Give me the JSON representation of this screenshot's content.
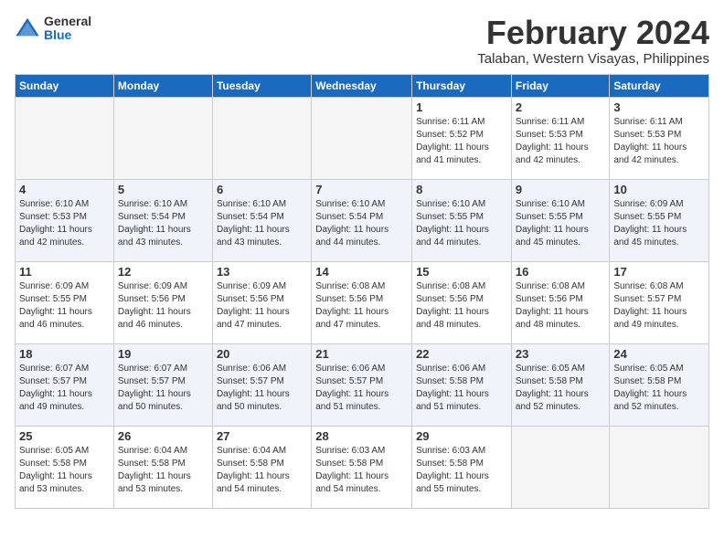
{
  "logo": {
    "general": "General",
    "blue": "Blue"
  },
  "title": "February 2024",
  "subtitle": "Talaban, Western Visayas, Philippines",
  "headers": [
    "Sunday",
    "Monday",
    "Tuesday",
    "Wednesday",
    "Thursday",
    "Friday",
    "Saturday"
  ],
  "weeks": [
    [
      {
        "day": "",
        "detail": "",
        "empty": true
      },
      {
        "day": "",
        "detail": "",
        "empty": true
      },
      {
        "day": "",
        "detail": "",
        "empty": true
      },
      {
        "day": "",
        "detail": "",
        "empty": true
      },
      {
        "day": "1",
        "detail": "Sunrise: 6:11 AM\nSunset: 5:52 PM\nDaylight: 11 hours\nand 41 minutes."
      },
      {
        "day": "2",
        "detail": "Sunrise: 6:11 AM\nSunset: 5:53 PM\nDaylight: 11 hours\nand 42 minutes."
      },
      {
        "day": "3",
        "detail": "Sunrise: 6:11 AM\nSunset: 5:53 PM\nDaylight: 11 hours\nand 42 minutes."
      }
    ],
    [
      {
        "day": "4",
        "detail": "Sunrise: 6:10 AM\nSunset: 5:53 PM\nDaylight: 11 hours\nand 42 minutes."
      },
      {
        "day": "5",
        "detail": "Sunrise: 6:10 AM\nSunset: 5:54 PM\nDaylight: 11 hours\nand 43 minutes."
      },
      {
        "day": "6",
        "detail": "Sunrise: 6:10 AM\nSunset: 5:54 PM\nDaylight: 11 hours\nand 43 minutes."
      },
      {
        "day": "7",
        "detail": "Sunrise: 6:10 AM\nSunset: 5:54 PM\nDaylight: 11 hours\nand 44 minutes."
      },
      {
        "day": "8",
        "detail": "Sunrise: 6:10 AM\nSunset: 5:55 PM\nDaylight: 11 hours\nand 44 minutes."
      },
      {
        "day": "9",
        "detail": "Sunrise: 6:10 AM\nSunset: 5:55 PM\nDaylight: 11 hours\nand 45 minutes."
      },
      {
        "day": "10",
        "detail": "Sunrise: 6:09 AM\nSunset: 5:55 PM\nDaylight: 11 hours\nand 45 minutes."
      }
    ],
    [
      {
        "day": "11",
        "detail": "Sunrise: 6:09 AM\nSunset: 5:55 PM\nDaylight: 11 hours\nand 46 minutes."
      },
      {
        "day": "12",
        "detail": "Sunrise: 6:09 AM\nSunset: 5:56 PM\nDaylight: 11 hours\nand 46 minutes."
      },
      {
        "day": "13",
        "detail": "Sunrise: 6:09 AM\nSunset: 5:56 PM\nDaylight: 11 hours\nand 47 minutes."
      },
      {
        "day": "14",
        "detail": "Sunrise: 6:08 AM\nSunset: 5:56 PM\nDaylight: 11 hours\nand 47 minutes."
      },
      {
        "day": "15",
        "detail": "Sunrise: 6:08 AM\nSunset: 5:56 PM\nDaylight: 11 hours\nand 48 minutes."
      },
      {
        "day": "16",
        "detail": "Sunrise: 6:08 AM\nSunset: 5:56 PM\nDaylight: 11 hours\nand 48 minutes."
      },
      {
        "day": "17",
        "detail": "Sunrise: 6:08 AM\nSunset: 5:57 PM\nDaylight: 11 hours\nand 49 minutes."
      }
    ],
    [
      {
        "day": "18",
        "detail": "Sunrise: 6:07 AM\nSunset: 5:57 PM\nDaylight: 11 hours\nand 49 minutes."
      },
      {
        "day": "19",
        "detail": "Sunrise: 6:07 AM\nSunset: 5:57 PM\nDaylight: 11 hours\nand 50 minutes."
      },
      {
        "day": "20",
        "detail": "Sunrise: 6:06 AM\nSunset: 5:57 PM\nDaylight: 11 hours\nand 50 minutes."
      },
      {
        "day": "21",
        "detail": "Sunrise: 6:06 AM\nSunset: 5:57 PM\nDaylight: 11 hours\nand 51 minutes."
      },
      {
        "day": "22",
        "detail": "Sunrise: 6:06 AM\nSunset: 5:58 PM\nDaylight: 11 hours\nand 51 minutes."
      },
      {
        "day": "23",
        "detail": "Sunrise: 6:05 AM\nSunset: 5:58 PM\nDaylight: 11 hours\nand 52 minutes."
      },
      {
        "day": "24",
        "detail": "Sunrise: 6:05 AM\nSunset: 5:58 PM\nDaylight: 11 hours\nand 52 minutes."
      }
    ],
    [
      {
        "day": "25",
        "detail": "Sunrise: 6:05 AM\nSunset: 5:58 PM\nDaylight: 11 hours\nand 53 minutes."
      },
      {
        "day": "26",
        "detail": "Sunrise: 6:04 AM\nSunset: 5:58 PM\nDaylight: 11 hours\nand 53 minutes."
      },
      {
        "day": "27",
        "detail": "Sunrise: 6:04 AM\nSunset: 5:58 PM\nDaylight: 11 hours\nand 54 minutes."
      },
      {
        "day": "28",
        "detail": "Sunrise: 6:03 AM\nSunset: 5:58 PM\nDaylight: 11 hours\nand 54 minutes."
      },
      {
        "day": "29",
        "detail": "Sunrise: 6:03 AM\nSunset: 5:58 PM\nDaylight: 11 hours\nand 55 minutes."
      },
      {
        "day": "",
        "detail": "",
        "empty": true
      },
      {
        "day": "",
        "detail": "",
        "empty": true
      }
    ]
  ]
}
